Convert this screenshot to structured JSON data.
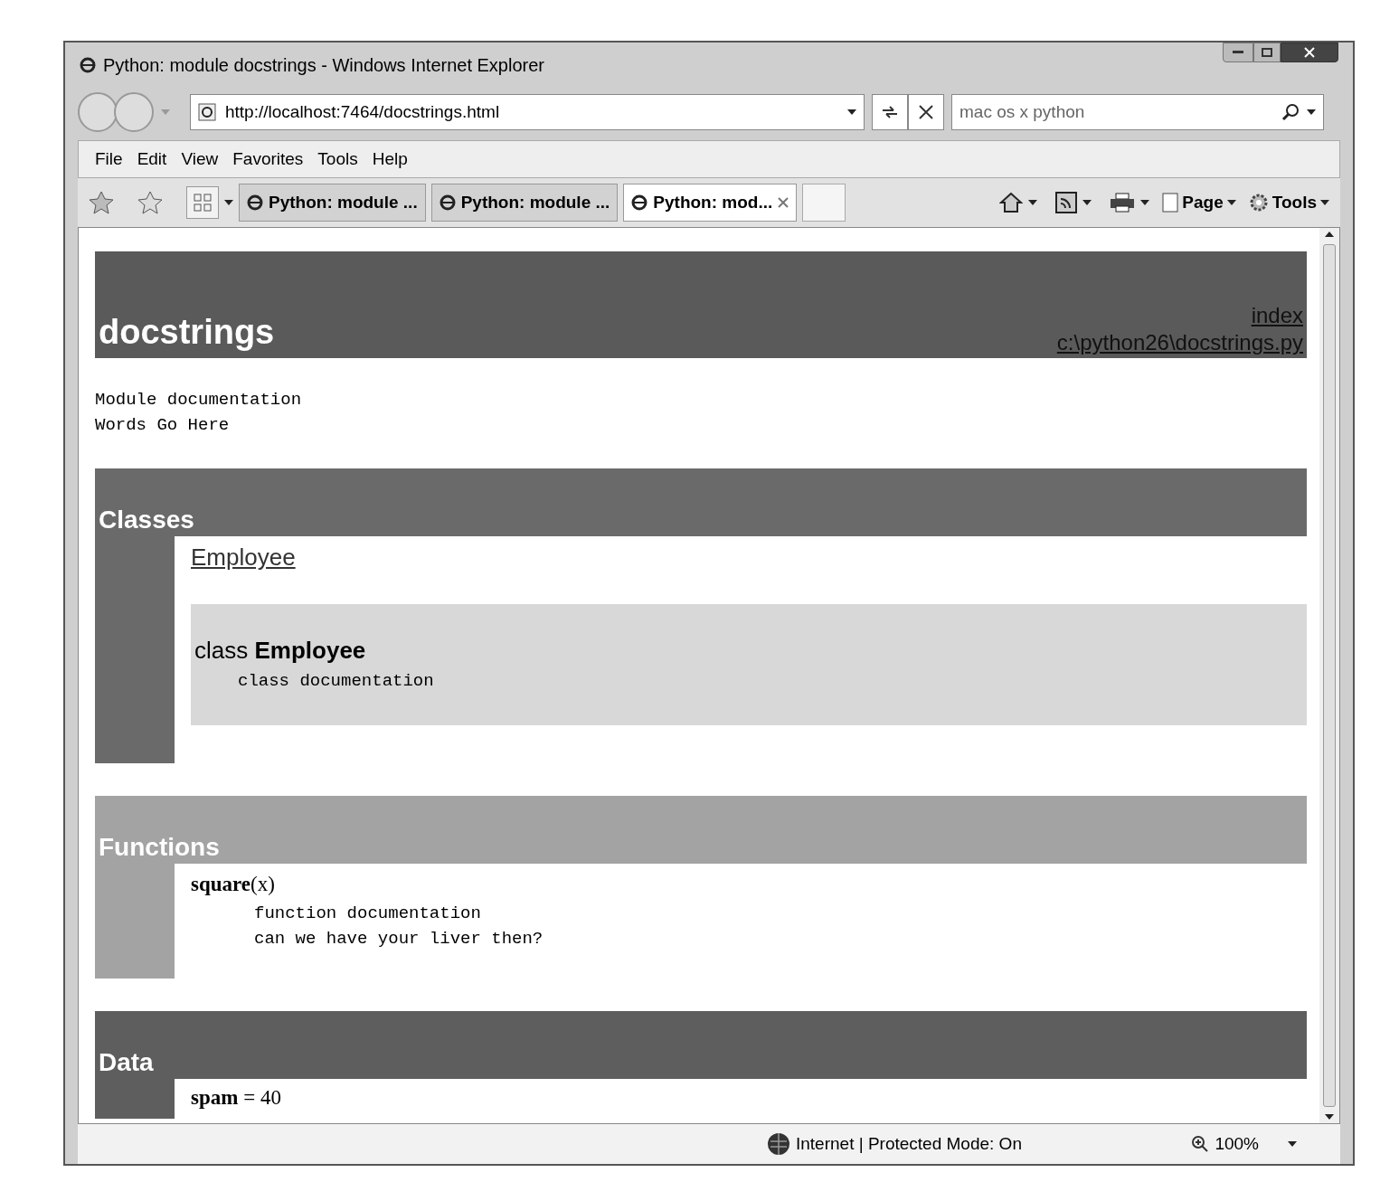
{
  "window": {
    "title": "Python: module docstrings - Windows Internet Explorer"
  },
  "address_bar": {
    "value": "http://localhost:7464/docstrings.html"
  },
  "search": {
    "value": "mac os x python"
  },
  "menu": [
    "File",
    "Edit",
    "View",
    "Favorites",
    "Tools",
    "Help"
  ],
  "tabs": [
    {
      "label": "Python: module ...",
      "selected": false
    },
    {
      "label": "Python: module ...",
      "selected": false
    },
    {
      "label": "Python: mod...",
      "selected": true
    }
  ],
  "command_bar": [
    "Page",
    "Tools"
  ],
  "page": {
    "heading": "docstrings",
    "links": [
      "index",
      "c:\\python26\\docstrings.py"
    ],
    "module_doc": [
      "Module documentation",
      "Words Go Here"
    ],
    "sections": [
      {
        "kind": "classes",
        "title": "Classes",
        "color": "#6a6a6a",
        "index_link": "Employee",
        "class_title": "class **Employee**",
        "class_doc": "class documentation"
      },
      {
        "kind": "functions",
        "title": "Functions",
        "color": "#a3a3a3",
        "signature": "**square**(x)",
        "doc": [
          "function documentation",
          "can we have your liver then?"
        ]
      },
      {
        "kind": "data",
        "title": "Data",
        "color": "#5e5e5e",
        "entry": "**spam** = 40"
      }
    ]
  },
  "status_bar": {
    "zone": "Internet | Protected Mode: On",
    "zoom": "100%"
  }
}
